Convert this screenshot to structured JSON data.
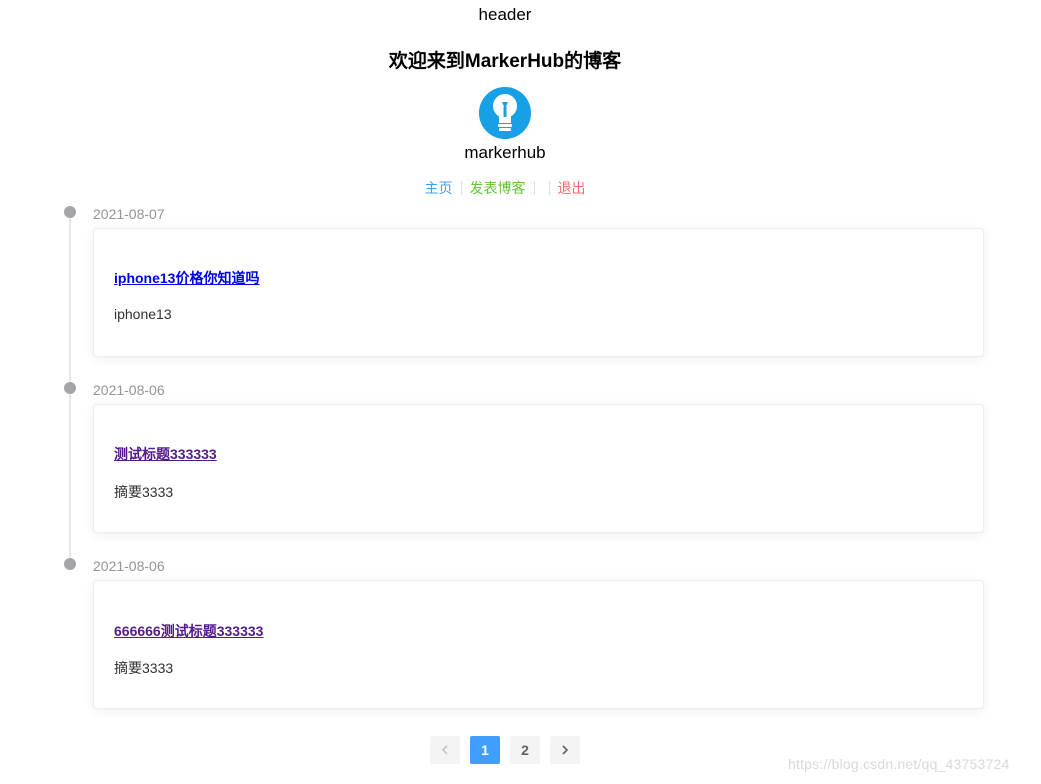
{
  "header": {
    "label": "header"
  },
  "profile": {
    "welcome": "欢迎来到MarkerHub的博客",
    "username": "markerhub",
    "avatar_icon": "lightbulb-icon",
    "avatar_color": "#18a0e6"
  },
  "nav": {
    "home": "主页",
    "post": "发表博客",
    "logout": "退出"
  },
  "timeline": {
    "items": [
      {
        "date": "2021-08-07",
        "title": "iphone13价格你知道吗",
        "summary": "iphone13"
      },
      {
        "date": "2021-08-06",
        "title": "测试标题333333",
        "summary": "摘要3333"
      },
      {
        "date": "2021-08-06",
        "title": "666666测试标题333333",
        "summary": "摘要3333"
      }
    ]
  },
  "pagination": {
    "prev_icon": "chevron-left-icon",
    "next_icon": "chevron-right-icon",
    "pages": [
      "1",
      "2"
    ],
    "current": "1"
  },
  "watermark": "https://blog.csdn.net/qq_43753724",
  "colors": {
    "primary": "#409eff",
    "success": "#67c23a",
    "danger": "#f56c6c"
  }
}
